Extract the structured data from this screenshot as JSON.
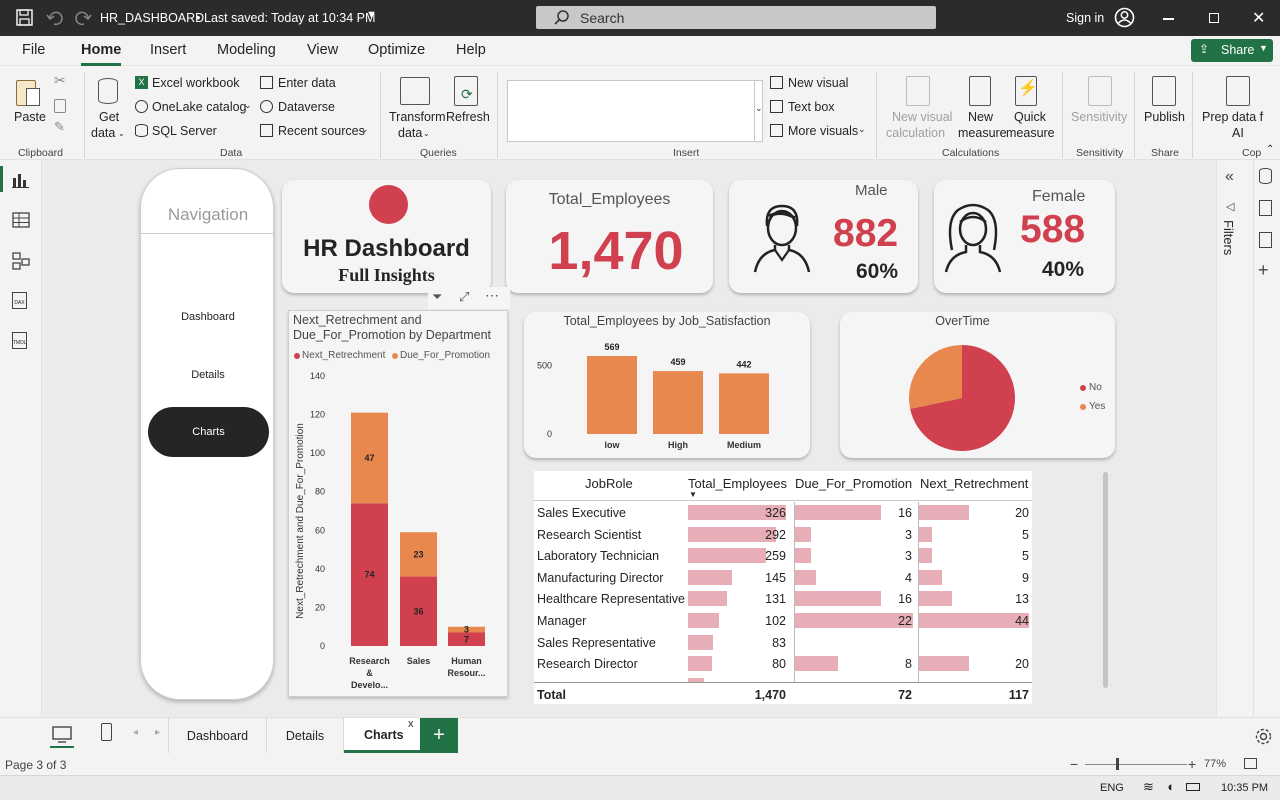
{
  "titlebar": {
    "filename": "HR_DASHBOARD",
    "saved": "Last saved: Today at 10:34 PM",
    "search_placeholder": "Search",
    "signin": "Sign in"
  },
  "tabs": [
    "File",
    "Home",
    "Insert",
    "Modeling",
    "View",
    "Optimize",
    "Help"
  ],
  "share_label": "Share",
  "ribbon": {
    "paste": "Paste",
    "clipboard": "Clipboard",
    "get_data": "Get",
    "get_data2": "data",
    "excel": "Excel workbook",
    "onelake": "OneLake catalog",
    "sql": "SQL Server",
    "enter_data": "Enter data",
    "dataverse": "Dataverse",
    "recent": "Recent sources",
    "data_group": "Data",
    "transform": "Transform",
    "transform2": "data",
    "refresh": "Refresh",
    "queries": "Queries",
    "new_visual": "New visual",
    "text_box": "Text box",
    "more_visuals": "More visuals",
    "insert": "Insert",
    "new_visual_calc": "New visual",
    "new_visual_calc2": "calculation",
    "new_measure": "New",
    "new_measure2": "measure",
    "quick_measure": "Quick",
    "quick_measure2": "measure",
    "calculations": "Calculations",
    "sensitivity": "Sensitivity",
    "sensitivity_group": "Sensitivity",
    "publish": "Publish",
    "share_group": "Share",
    "prep": "Prep data f",
    "prep2": "AI",
    "cop": "Cop"
  },
  "nav": {
    "title": "Navigation",
    "dashboard": "Dashboard",
    "details": "Details",
    "charts": "Charts"
  },
  "header": {
    "title": "HR Dashboard",
    "subtitle": "Full Insights"
  },
  "kpis": {
    "total_label": "Total_Employees",
    "total_value": "1,470",
    "male_label": "Male",
    "male_value": "882",
    "male_pct": "60%",
    "female_label": "Female",
    "female_value": "588",
    "female_pct": "40%"
  },
  "colors": {
    "red": "#d0404e",
    "orange": "#e8884f",
    "accent_green": "#217346"
  },
  "charts_text": {
    "stacked_title1": "Next_Retrechment and",
    "stacked_title2": "Due_For_Promotion by Department",
    "legend_a": "Next_Retrechment",
    "legend_b": "Due_For_Promotion",
    "stacked_ylabel": "Next_Retrechment and Due_For_Promotion",
    "js_title": "Total_Employees by Job_Satisfaction",
    "ot_title": "OverTime",
    "ot_no": "No",
    "ot_yes": "Yes"
  },
  "chart_data": [
    {
      "type": "bar",
      "title": "Next_Retrechment and Due_For_Promotion by Department",
      "categories": [
        "Research & Develo...",
        "Sales",
        "Human Resour..."
      ],
      "series": [
        {
          "name": "Next_Retrechment",
          "values": [
            74,
            36,
            7
          ]
        },
        {
          "name": "Due_For_Promotion",
          "values": [
            47,
            23,
            3
          ]
        }
      ],
      "stacked": true,
      "ylabel": "Next_Retrechment and Due_For_Promotion",
      "yticks": [
        0,
        20,
        40,
        60,
        80,
        100,
        120,
        140
      ],
      "ylim": [
        0,
        140
      ],
      "legend": "top-left"
    },
    {
      "type": "bar",
      "title": "Total_Employees by Job_Satisfaction",
      "categories": [
        "low",
        "High",
        "Medium"
      ],
      "values": [
        569,
        459,
        442
      ],
      "yticks": [
        0,
        500
      ],
      "ylim": [
        0,
        600
      ]
    },
    {
      "type": "pie",
      "title": "OverTime",
      "categories": [
        "No",
        "Yes"
      ],
      "values": [
        1054,
        416
      ],
      "legend": "right"
    }
  ],
  "table": {
    "headers": [
      "JobRole",
      "Total_Employees",
      "Due_For_Promotion",
      "Next_Retrechment"
    ],
    "rows": [
      {
        "role": "Sales Executive",
        "total": 326,
        "promo": 16,
        "retr": 20
      },
      {
        "role": "Research Scientist",
        "total": 292,
        "promo": 3,
        "retr": 5
      },
      {
        "role": "Laboratory Technician",
        "total": 259,
        "promo": 3,
        "retr": 5
      },
      {
        "role": "Manufacturing Director",
        "total": 145,
        "promo": 4,
        "retr": 9
      },
      {
        "role": "Healthcare Representative",
        "total": 131,
        "promo": 16,
        "retr": 13
      },
      {
        "role": "Manager",
        "total": 102,
        "promo": 22,
        "retr": 44
      },
      {
        "role": "Sales Representative",
        "total": 83,
        "promo": null,
        "retr": null
      },
      {
        "role": "Research Director",
        "total": 80,
        "promo": 8,
        "retr": 20
      }
    ],
    "total_label": "Total",
    "total_total": "1,470",
    "total_promo": "72",
    "total_retr": "117"
  },
  "pagetabs": {
    "dashboard": "Dashboard",
    "details": "Details",
    "charts": "Charts"
  },
  "status": {
    "page": "Page 3 of 3",
    "zoom": "77%",
    "lang": "ENG",
    "time": "10:35 PM"
  },
  "filters_label": "Filters"
}
